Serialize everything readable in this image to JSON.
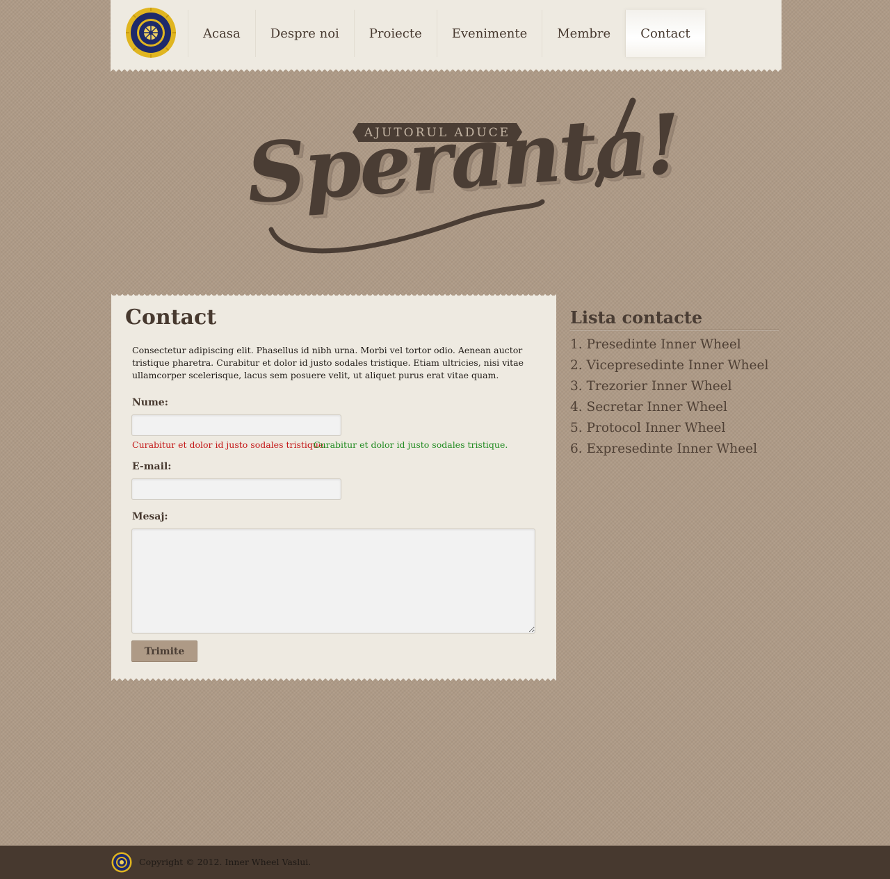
{
  "header": {
    "logo_icon": "inner-wheel-emblem",
    "nav": [
      {
        "label": "Acasa"
      },
      {
        "label": "Despre noi"
      },
      {
        "label": "Proiecte"
      },
      {
        "label": "Evenimente"
      },
      {
        "label": "Membre"
      },
      {
        "label": "Contact",
        "active": true
      }
    ]
  },
  "hero": {
    "banner": "AJUTORUL ADUCE",
    "script": "Speranta!"
  },
  "contact": {
    "title": "Contact",
    "intro": "Consectetur adipiscing elit. Phasellus id nibh urna. Morbi vel tortor odio. Aenean auctor tristique pharetra. Curabitur et dolor id justo sodales tristique. Etiam ultricies, nisi vitae ullamcorper scelerisque, lacus sem posuere velit, ut aliquet purus erat vitae quam.",
    "name_label": "Nume:",
    "name_value": "",
    "email_label": "E-mail:",
    "email_value": "",
    "message_label": "Mesaj:",
    "message_value": "",
    "error_text": "Curabitur et dolor id justo sodales tristique.",
    "success_text": "Curabitur et dolor id justo sodales tristique.",
    "submit_label": "Trimite"
  },
  "sidebar": {
    "title": "Lista contacte",
    "items": [
      {
        "label": "1. Presedinte Inner Wheel"
      },
      {
        "label": "2. Vicepresedinte Inner Wheel"
      },
      {
        "label": "3. Trezorier Inner Wheel"
      },
      {
        "label": "4. Secretar Inner Wheel"
      },
      {
        "label": "5. Protocol Inner Wheel"
      },
      {
        "label": "6. Expresedinte Inner Wheel"
      }
    ]
  },
  "footer": {
    "copyright": "Copyright © 2012. Inner Wheel Vaslui."
  },
  "colors": {
    "background": "#ae9a86",
    "paper": "#eeeae1",
    "text_dark": "#47392f",
    "error": "#c31515",
    "success": "#1f8a1f",
    "emblem_blue": "#1e2a6b",
    "emblem_gold": "#e0b520"
  }
}
